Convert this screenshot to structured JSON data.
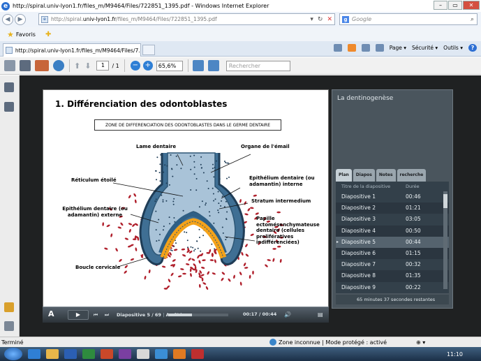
{
  "window": {
    "title": "http://spiral.univ-lyon1.fr/files_m/M9464/Files/722851_1395.pdf - Windows Internet Explorer"
  },
  "address": {
    "url_prefix": "http://spiral.",
    "url_domain": "univ-lyon1.fr",
    "url_rest": "/files_m/M9464/Files/722851_1395.pdf"
  },
  "search": {
    "placeholder": "Google"
  },
  "favorites": {
    "label": "Favoris"
  },
  "tab": {
    "label": "http://spiral.univ-lyon1.fr/files_m/M9464/Files/7..."
  },
  "commandbar": {
    "page": "Page ▾",
    "security": "Sécurité ▾",
    "tools": "Outils ▾"
  },
  "pdf_toolbar": {
    "page_current": "1",
    "page_total": "/ 1",
    "zoom": "65,6%",
    "search_placeholder": "Rechercher"
  },
  "slide": {
    "title": "1. Différenciation des odontoblastes",
    "zone_title": "ZONE DE DIFFERENCIATION DES ODONTOBLASTES DANS LE GERME DENTAIRE",
    "labels": {
      "lame": "Lame dentaire",
      "organe": "Organe de l'émail",
      "reticulum": "Réticulum étoilé",
      "epi_int": "Epithélium dentaire (ou adamantin) interne",
      "stratum": "Stratum intermedium",
      "epi_ext": "Epithélium dentaire (ou adamantin) externe",
      "papille": "Papille ectomésenchymateuse dentaire (cellules prolifératives indifférenciées)",
      "boucle": "Boucle cervicale"
    }
  },
  "player": {
    "slide_info": "Diapositive 5 / 69",
    "status": "Arrêtée",
    "time": "00:17 / 00:44",
    "progress": 0.39
  },
  "sidebar": {
    "title": "La dentinogenèse",
    "tabs": [
      "Plan",
      "Diapos",
      "Notes",
      "recherche"
    ],
    "col_title": "Titre de la diapositive",
    "col_duration": "Durée",
    "rows": [
      {
        "name": "Diapositive 1",
        "duration": "00:46"
      },
      {
        "name": "Diapositive 2",
        "duration": "01:21"
      },
      {
        "name": "Diapositive 3",
        "duration": "03:05"
      },
      {
        "name": "Diapositive 4",
        "duration": "00:50"
      },
      {
        "name": "Diapositive 5",
        "duration": "00:44"
      },
      {
        "name": "Diapositive 6",
        "duration": "01:15"
      },
      {
        "name": "Diapositive 7",
        "duration": "00:32"
      },
      {
        "name": "Diapositive 8",
        "duration": "01:35"
      },
      {
        "name": "Diapositive 9",
        "duration": "00:22"
      }
    ],
    "footer": "65 minutes 37 secondes restantes"
  },
  "statusbar": {
    "left": "Terminé",
    "zone": "Zone inconnue | Mode protégé : activé",
    "zoom": "⊕ ▾"
  },
  "taskbar": {
    "clock": "11:10"
  },
  "colors": {
    "accent": "#1f5aa8",
    "enamel": "#f4a21a",
    "cells": "#b0202c"
  }
}
